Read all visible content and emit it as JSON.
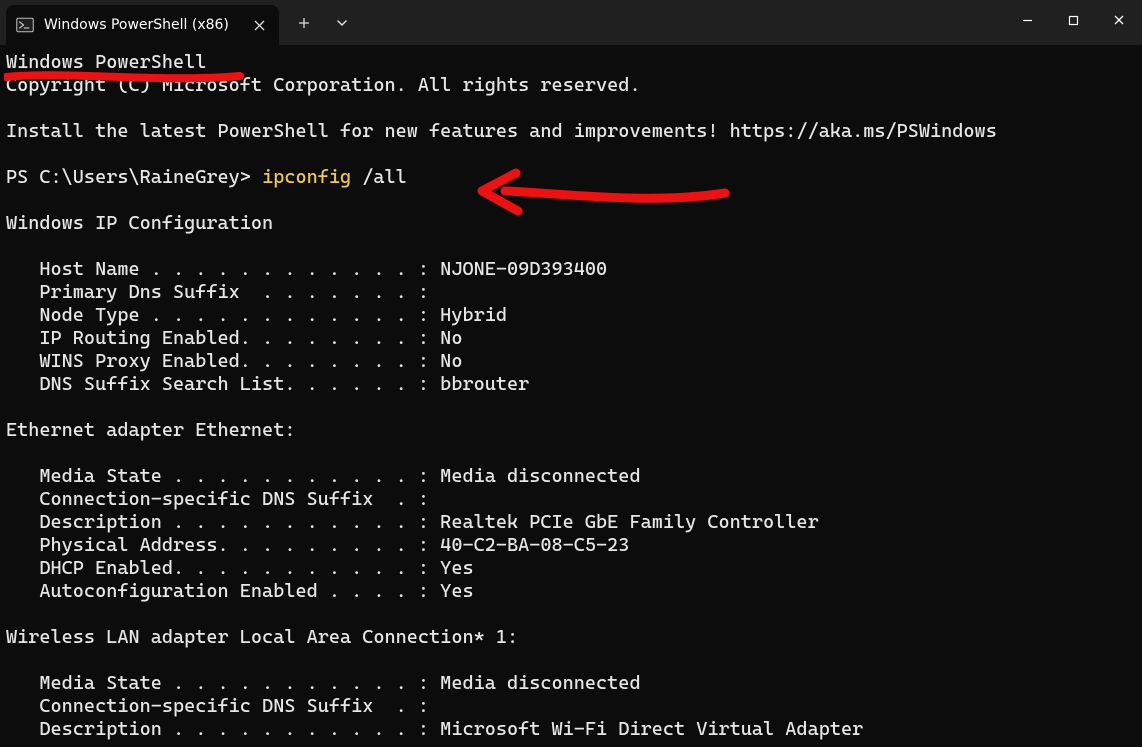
{
  "tab": {
    "title": "Windows PowerShell (x86)"
  },
  "terminal": {
    "header1": "Windows PowerShell",
    "header2": "Copyright (C) Microsoft Corporation. All rights reserved.",
    "install_msg": "Install the latest PowerShell for new features and improvements! https://aka.ms/PSWindows",
    "prompt_prefix": "PS C:\\Users\\RaineGrey> ",
    "command_name": "ipconfig",
    "command_args": " /all",
    "ipconfig_title": "Windows IP Configuration",
    "ipconfig_lines": [
      "   Host Name . . . . . . . . . . . . : NJONE-09D393400",
      "   Primary Dns Suffix  . . . . . . . :",
      "   Node Type . . . . . . . . . . . . : Hybrid",
      "   IP Routing Enabled. . . . . . . . : No",
      "   WINS Proxy Enabled. . . . . . . . : No",
      "   DNS Suffix Search List. . . . . . : bbrouter"
    ],
    "adapter1_title": "Ethernet adapter Ethernet:",
    "adapter1_lines": [
      "   Media State . . . . . . . . . . . : Media disconnected",
      "   Connection-specific DNS Suffix  . :",
      "   Description . . . . . . . . . . . : Realtek PCIe GbE Family Controller",
      "   Physical Address. . . . . . . . . : 40-C2-BA-08-C5-23",
      "   DHCP Enabled. . . . . . . . . . . : Yes",
      "   Autoconfiguration Enabled . . . . : Yes"
    ],
    "adapter2_title": "Wireless LAN adapter Local Area Connection* 1:",
    "adapter2_lines": [
      "   Media State . . . . . . . . . . . : Media disconnected",
      "   Connection-specific DNS Suffix  . :",
      "   Description . . . . . . . . . . . : Microsoft Wi-Fi Direct Virtual Adapter"
    ]
  }
}
